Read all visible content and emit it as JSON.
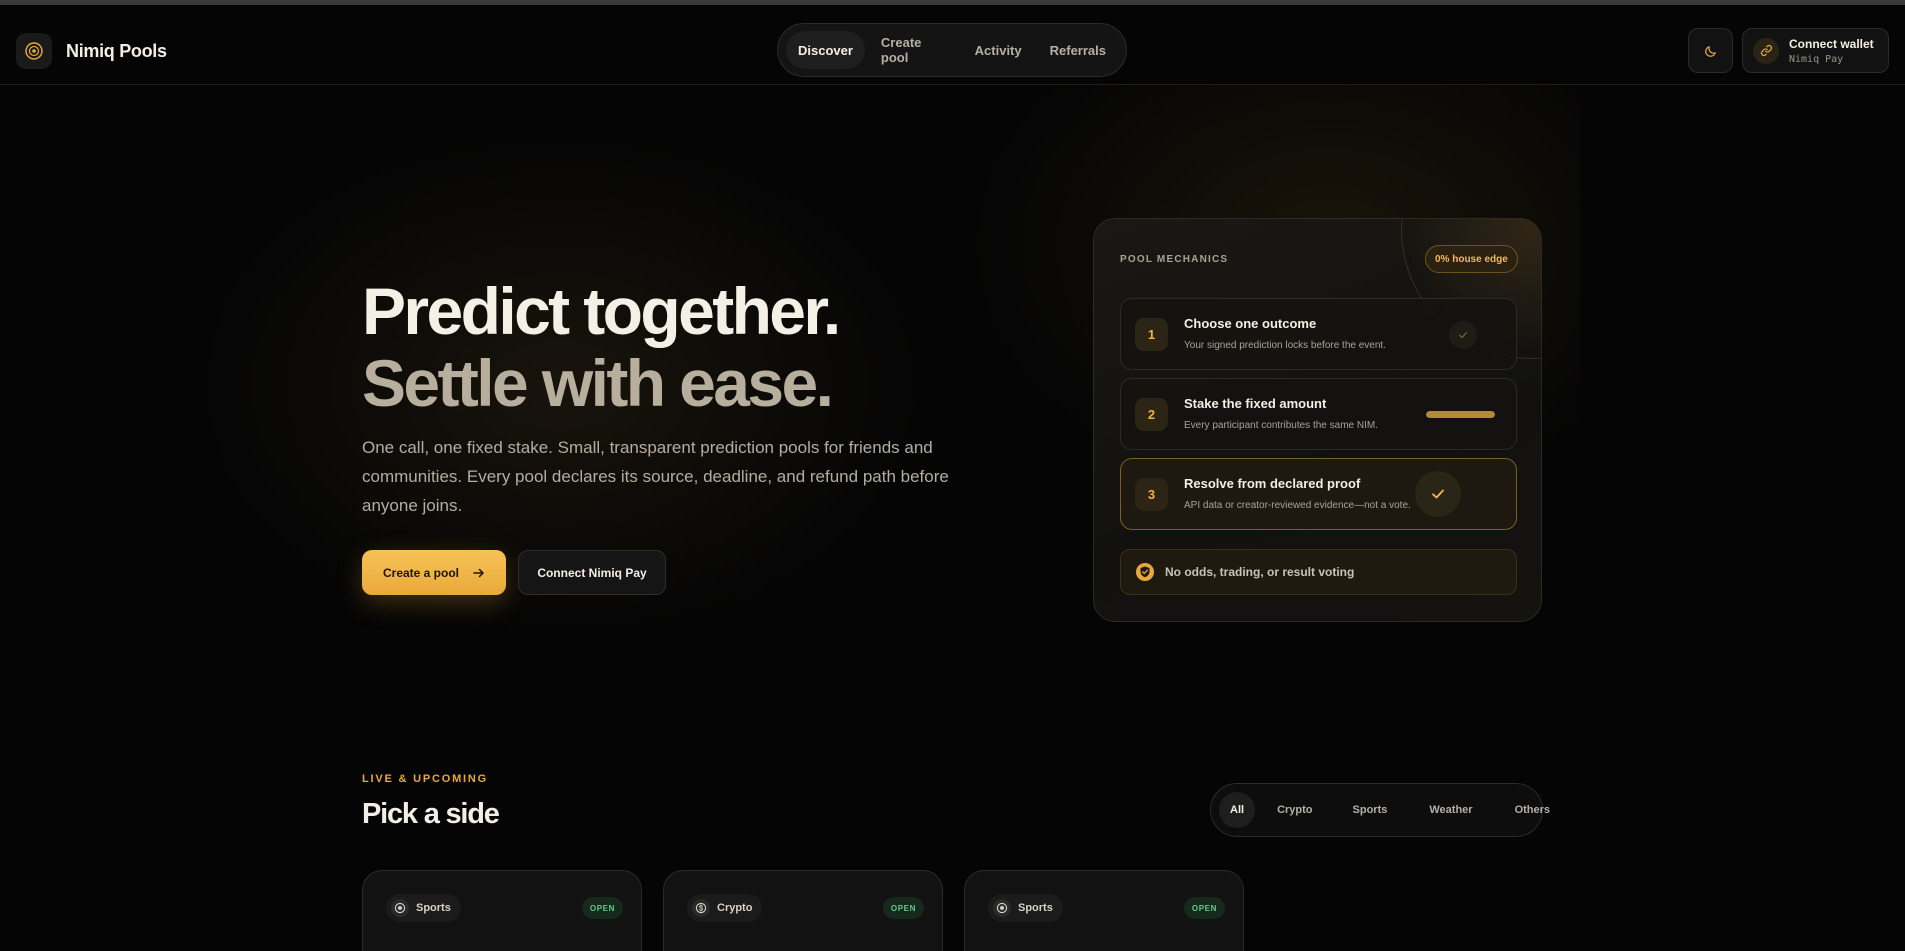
{
  "header": {
    "brand": "Nimiq Pools",
    "nav": [
      {
        "label": "Discover",
        "active": true
      },
      {
        "label": "Create pool"
      },
      {
        "label": "Activity"
      },
      {
        "label": "Referrals"
      }
    ],
    "theme_icon": "moon-icon",
    "wallet": {
      "title": "Connect wallet",
      "subtitle": "Nimiq Pay",
      "icon": "link-icon"
    }
  },
  "hero": {
    "title_line1": "Predict together.",
    "title_line2": "Settle with ease.",
    "description": "One call, one fixed stake. Small, transparent prediction pools for friends and communities. Every pool declares its source, deadline, and refund path before anyone joins.",
    "primary_button": "Create a pool",
    "secondary_button": "Connect Nimiq Pay"
  },
  "mechanics": {
    "label": "POOL MECHANICS",
    "badge": "0% house edge",
    "steps": [
      {
        "num": "1",
        "title": "Choose one outcome",
        "subtitle": "Your signed prediction locks before the event."
      },
      {
        "num": "2",
        "title": "Stake the fixed amount",
        "subtitle": "Every participant contributes the same NIM.",
        "progress": 1.0
      },
      {
        "num": "3",
        "title": "Resolve from declared proof",
        "subtitle": "API data or creator-reviewed evidence—not a vote."
      }
    ],
    "footer": "No odds, trading, or result voting"
  },
  "live": {
    "eyebrow": "LIVE & UPCOMING",
    "title": "Pick a side",
    "filters": [
      "All",
      "Crypto",
      "Sports",
      "Weather",
      "Others"
    ],
    "active_filter": "All",
    "pools": [
      {
        "category": "Sports",
        "status": "OPEN"
      },
      {
        "category": "Crypto",
        "status": "OPEN"
      },
      {
        "category": "Sports",
        "status": "OPEN"
      }
    ]
  },
  "colors": {
    "accent": "#e9a93a",
    "background": "#050505",
    "open_status": "#62c98a"
  }
}
